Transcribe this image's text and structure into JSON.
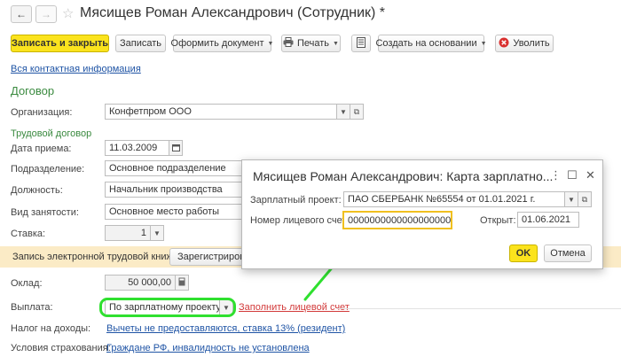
{
  "header": {
    "title": "Мясищев Роман Александрович (Сотрудник) *",
    "back_icon": "←",
    "forward_icon": "→",
    "star_icon": "☆"
  },
  "toolbar": {
    "save_close": "Записать и закрыть",
    "save": "Записать",
    "make_document": "Оформить документ",
    "print": "Печать",
    "create_based": "Создать на основании",
    "dismiss": "Уволить"
  },
  "form": {
    "contact_link": "Вся контактная информация",
    "contract_section": "Договор",
    "organization_label": "Организация:",
    "organization_value": "Конфетпром ООО",
    "labor_contract_section": "Трудовой договор",
    "hire_date_label": "Дата приема:",
    "hire_date_value": "11.03.2009",
    "department_label": "Подразделение:",
    "department_value": "Основное подразделение",
    "position_label": "Должность:",
    "position_value": "Начальник производства",
    "employment_label": "Вид занятости:",
    "employment_value": "Основное место работы",
    "rate_label": "Ставка:",
    "rate_value": "1",
    "etk_label": "Запись электронной трудовой книжки:",
    "etk_button": "Зарегистрировать",
    "salary_label": "Оклад:",
    "salary_value": "50 000,00",
    "payment_label": "Выплата:",
    "payment_value": "По зарплатному проекту",
    "fill_account_link": "Заполнить лицевой счет",
    "tax_label": "Налог на доходы:",
    "tax_value": "Вычеты не предоставляются, ставка 13% (резидент)",
    "insurance_label": "Условия страхования:",
    "insurance_value": "Граждане РФ, инвалидность не установлена"
  },
  "dialog": {
    "title": "Мясищев Роман Александрович: Карта зарплатно...",
    "project_label": "Зарплатный проект:",
    "project_value": "ПАО СБЕРБАНК №65554 от 01.01.2021 г.",
    "account_label": "Номер лицевого счета:",
    "account_value": "00000000000000000000",
    "opened_label": "Открыт:",
    "opened_value": "01.06.2021",
    "ok": "OK",
    "cancel": "Отмена"
  },
  "colors": {
    "primary_button": "#fbe31d",
    "section_green": "#3a8a3f",
    "link_blue": "#1f54a5",
    "annotation_green": "#2fe02f",
    "band": "#fbebc6"
  }
}
